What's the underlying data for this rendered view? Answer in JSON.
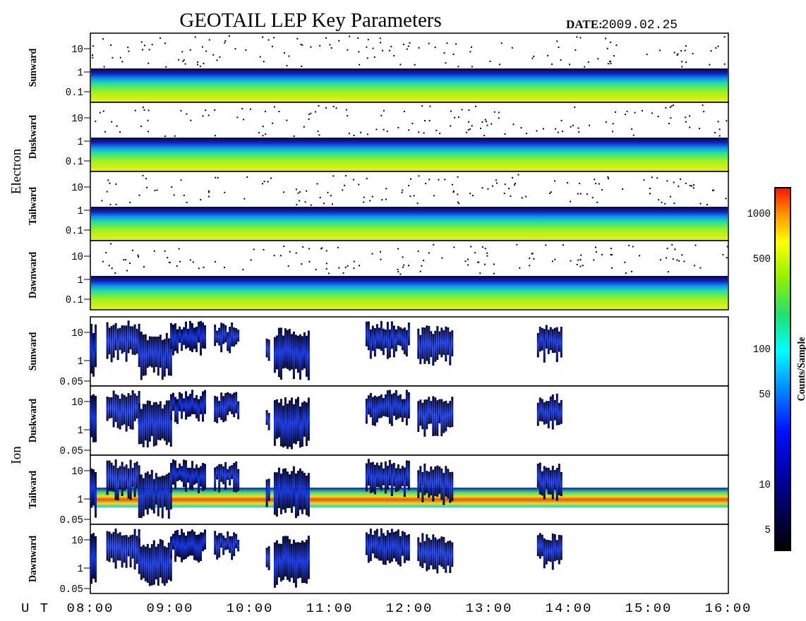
{
  "title": "GEOTAIL LEP Key Parameters",
  "date": {
    "label": "DATE:",
    "value": "2009.02.25"
  },
  "groups": [
    {
      "name": "Electron",
      "kind": "electron",
      "panels": [
        {
          "label": "Sunward",
          "yticks": [
            "10",
            "1",
            "0.1"
          ]
        },
        {
          "label": "Duskward",
          "yticks": [
            "10",
            "1",
            "0.1"
          ]
        },
        {
          "label": "Tailward",
          "yticks": [
            "10",
            "1",
            "0.1"
          ]
        },
        {
          "label": "Dawnward",
          "yticks": [
            "10",
            "1",
            "0.1"
          ]
        }
      ]
    },
    {
      "name": "Ion",
      "kind": "ion",
      "panels": [
        {
          "label": "Sunward",
          "yticks": [
            "10",
            "1",
            "0.05"
          ]
        },
        {
          "label": "Duskward",
          "yticks": [
            "10",
            "1",
            "0.05"
          ]
        },
        {
          "label": "Tailward",
          "yticks": [
            "10",
            "1",
            "0.05"
          ]
        },
        {
          "label": "Dawnward",
          "yticks": [
            "10",
            "1",
            "0.05"
          ]
        }
      ]
    }
  ],
  "colorbar": {
    "label": "Counts/Sample",
    "ticks": [
      "1000",
      "500",
      "100",
      "50",
      "10",
      "5"
    ]
  },
  "x_axis": {
    "label": "U T",
    "ticks": [
      "08:00",
      "09:00",
      "10:00",
      "11:00",
      "12:00",
      "13:00",
      "14:00",
      "15:00",
      "16:00"
    ]
  }
}
